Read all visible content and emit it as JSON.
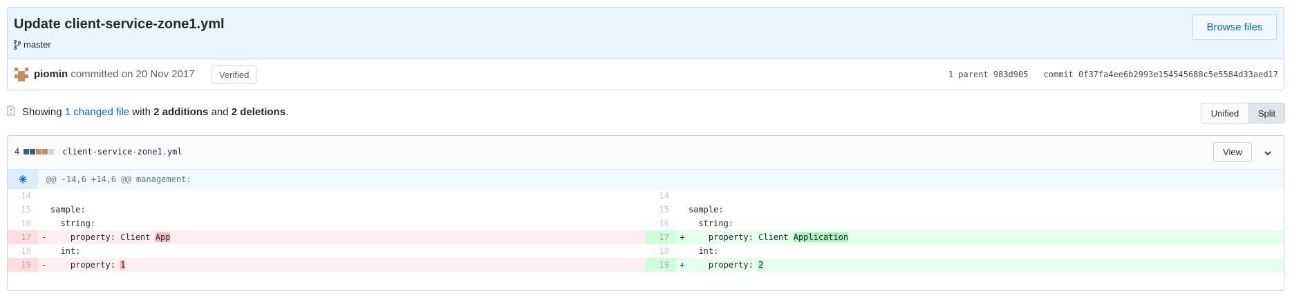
{
  "commit": {
    "title": "Update client-service-zone1.yml",
    "branch": "master",
    "browse_label": "Browse files",
    "author": "piomin",
    "committed_text": " committed on 20 Nov 2017",
    "verified_label": "Verified",
    "parent_text": "1 parent 983d905",
    "commit_text": "commit 0f37fa4ee6b2993e154545688c5e5584d33aed17"
  },
  "toc": {
    "prefix": "Showing ",
    "link": "1 changed file",
    "mid": " with ",
    "additions": "2 additions",
    "and": " and ",
    "deletions": "2 deletions",
    "suffix": "."
  },
  "view_toggle": {
    "unified": "Unified",
    "split": "Split"
  },
  "file": {
    "count": "4",
    "name": "client-service-zone1.yml",
    "view_label": "View",
    "hunk_header": "@@ -14,6 +14,6 @@ management:",
    "left": [
      {
        "num": "14",
        "sign": "",
        "code": "",
        "hl": ""
      },
      {
        "num": "15",
        "sign": "",
        "code": "sample:",
        "hl": ""
      },
      {
        "num": "16",
        "sign": "",
        "code": "  string:",
        "hl": ""
      },
      {
        "num": "17",
        "sign": "-",
        "code": "    property: Client ",
        "hl": "App"
      },
      {
        "num": "18",
        "sign": "",
        "code": "  int:",
        "hl": ""
      },
      {
        "num": "19",
        "sign": "-",
        "code": "    property: ",
        "hl": "1"
      }
    ],
    "right": [
      {
        "num": "14",
        "sign": "",
        "code": "",
        "hl": ""
      },
      {
        "num": "15",
        "sign": "",
        "code": "sample:",
        "hl": ""
      },
      {
        "num": "16",
        "sign": "",
        "code": "  string:",
        "hl": ""
      },
      {
        "num": "17",
        "sign": "+",
        "code": "    property: Client ",
        "hl": "Application"
      },
      {
        "num": "18",
        "sign": "",
        "code": "  int:",
        "hl": ""
      },
      {
        "num": "19",
        "sign": "+",
        "code": "    property: ",
        "hl": "2"
      }
    ]
  },
  "colors": {
    "link": "#0366d6",
    "add_bg": "#e6ffed",
    "del_bg": "#ffeef0"
  }
}
